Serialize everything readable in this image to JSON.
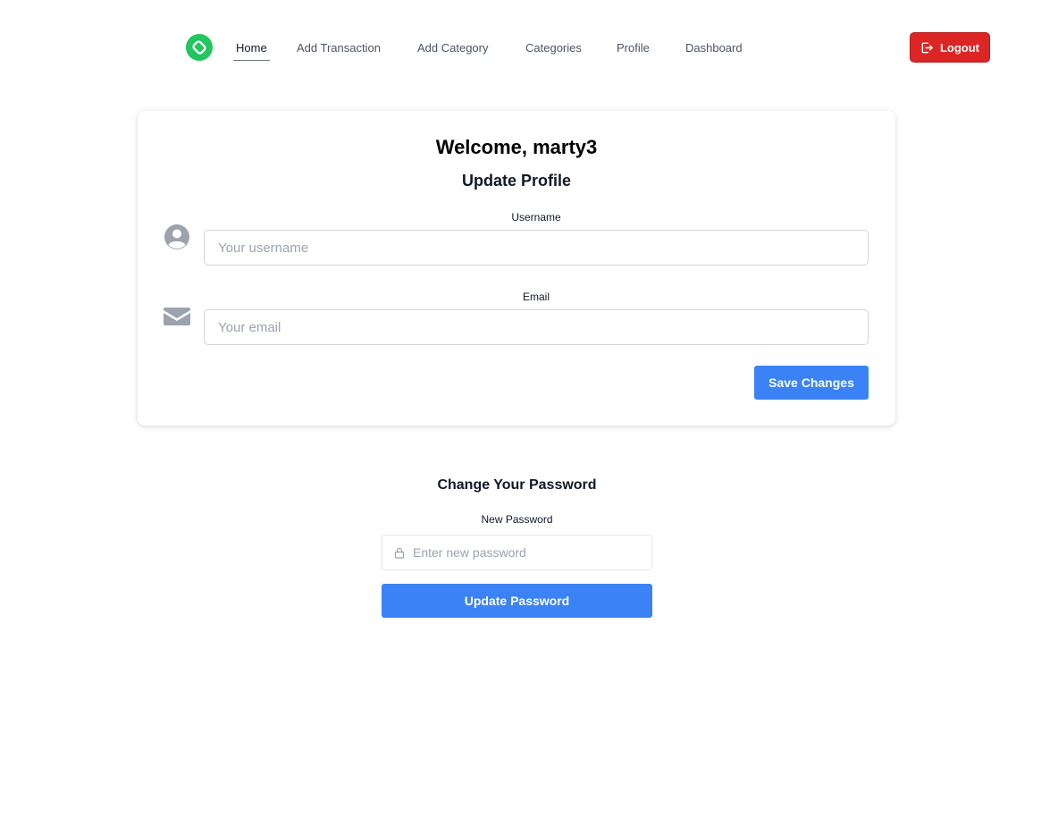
{
  "nav": {
    "logo_icon": "link-chain-icon",
    "brand_color": "#22c55e",
    "links": [
      {
        "label": "Home",
        "active": true
      },
      {
        "label": "Add Transaction"
      },
      {
        "label": "Add Category"
      },
      {
        "label": "Categories"
      },
      {
        "label": "Profile"
      },
      {
        "label": "Dashboard"
      }
    ],
    "logout": {
      "label": "Logout",
      "icon": "logout-icon",
      "color": "#dc2626"
    }
  },
  "profile": {
    "welcome": "Welcome, marty3",
    "subtitle": "Update Profile",
    "username": {
      "label": "Username",
      "placeholder": "Your username",
      "icon": "user-circle-icon",
      "value": ""
    },
    "email": {
      "label": "Email",
      "placeholder": "Your email",
      "icon": "envelope-icon",
      "value": ""
    },
    "save_label": "Save Changes",
    "accent": "#3b82f6"
  },
  "password": {
    "title": "Change Your Password",
    "label": "New Password",
    "placeholder": "Enter new password",
    "icon": "lock-icon",
    "value": "",
    "submit_label": "Update Password"
  }
}
